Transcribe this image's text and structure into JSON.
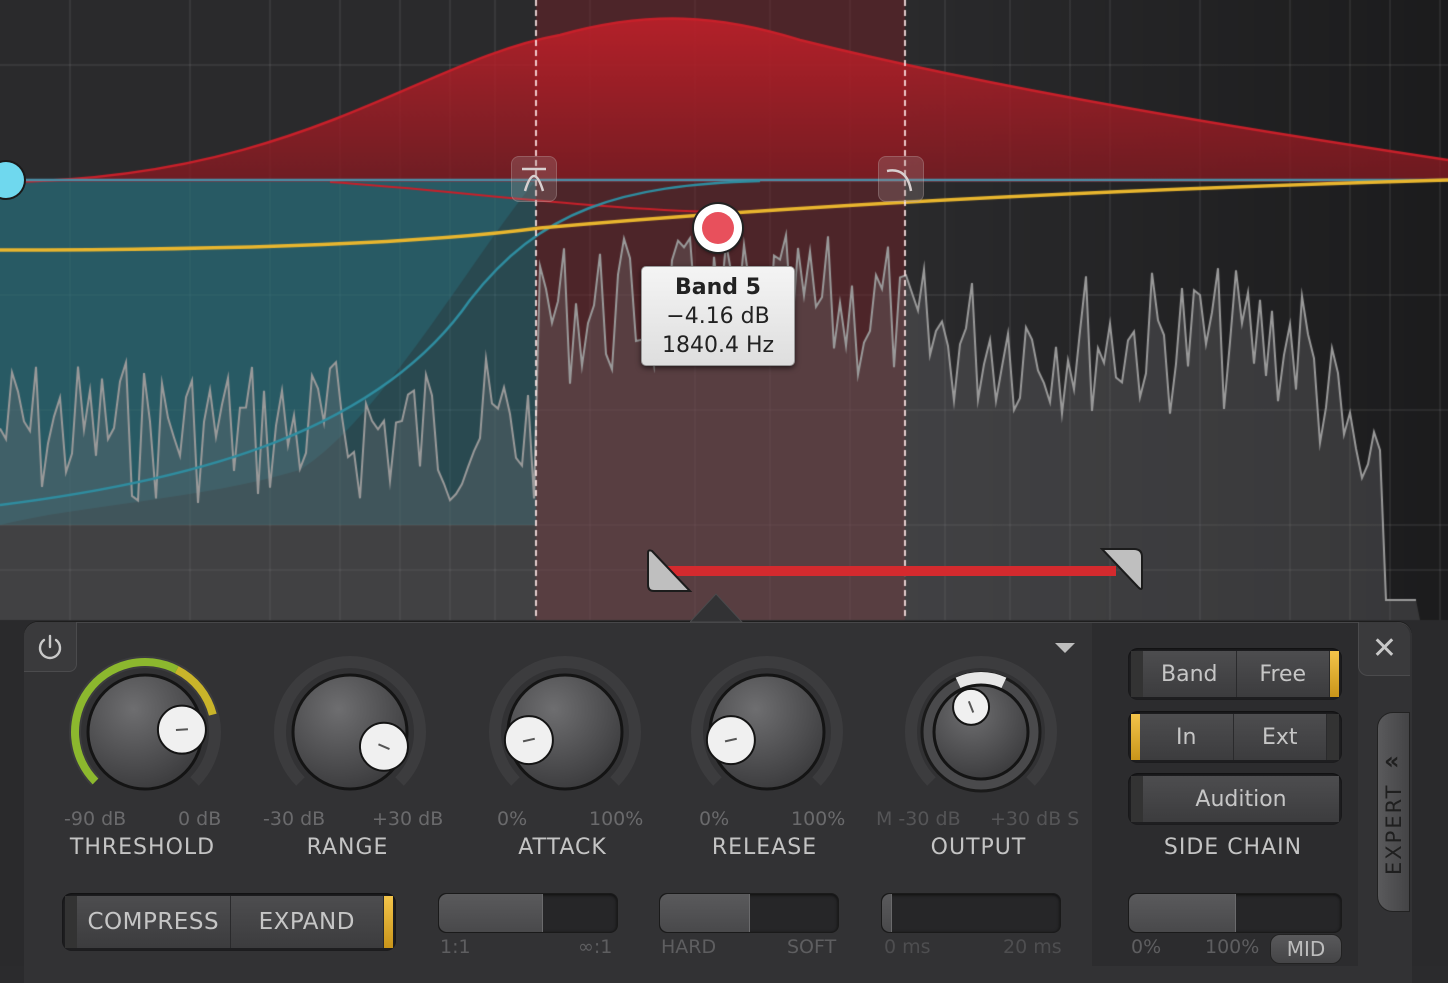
{
  "analyzer": {
    "selected_band": {
      "name": "Band 5",
      "gain": "−4.16 dB",
      "frequency": "1840.4 Hz",
      "color": "#e8505c"
    },
    "low_band_handle_color": "#6fd8ee",
    "curve_colors": {
      "band5": "#c8202a",
      "lowband": "#2f8da0",
      "eq_curve": "#e9b62e",
      "spectrum": "#9a9a9a"
    },
    "band5_filter_left_icon": "bandpass-filter-icon",
    "band5_filter_right_icon": "highcut-filter-icon",
    "sidechain_range_bar_color": "#d42a2e"
  },
  "panel": {
    "power_icon": "power-icon",
    "close_icon": "close-icon",
    "dropdown_icon": "triangle-down-icon",
    "knobs": [
      {
        "id": "threshold",
        "label": "THRESHOLD",
        "min_label": "-90 dB",
        "max_label": "0 dB",
        "value_fraction": 0.82,
        "meter_fraction": 0.78
      },
      {
        "id": "range",
        "label": "RANGE",
        "min_label": "-30 dB",
        "max_label": "+30 dB",
        "value_fraction": 0.92
      },
      {
        "id": "attack",
        "label": "ATTACK",
        "min_label": "0%",
        "max_label": "100%",
        "value_fraction": 0.12
      },
      {
        "id": "release",
        "label": "RELEASE",
        "min_label": "0%",
        "max_label": "100%",
        "value_fraction": 0.12
      },
      {
        "id": "output",
        "label": "OUTPUT",
        "min_label": "M -30 dB",
        "max_label": "+30 dB S",
        "value_fraction": 0.42
      }
    ],
    "mode_switch": {
      "options": [
        "COMPRESS",
        "EXPAND"
      ],
      "selected": "EXPAND"
    },
    "sliders": [
      {
        "id": "ratio",
        "min_label": "1:1",
        "max_label": "∞:1",
        "value_fraction": 0.58
      },
      {
        "id": "knee",
        "min_label": "HARD",
        "max_label": "SOFT",
        "value_fraction": 0.5
      },
      {
        "id": "lookahead",
        "min_label": "0 ms",
        "max_label": "20 ms",
        "value_fraction": 0.05
      },
      {
        "id": "stereo_link",
        "min_label": "0%",
        "max_label": "100%",
        "value_fraction": 0.5
      }
    ],
    "stereo_link_mode": "MID",
    "side_chain": {
      "title": "SIDE CHAIN",
      "filter_mode": {
        "options": [
          "Band",
          "Free"
        ],
        "selected": "Free"
      },
      "source": {
        "options": [
          "In",
          "Ext"
        ],
        "selected": "In"
      },
      "audition_label": "Audition"
    },
    "expert_tab": {
      "label": "EXPERT",
      "chevron": "«"
    }
  }
}
